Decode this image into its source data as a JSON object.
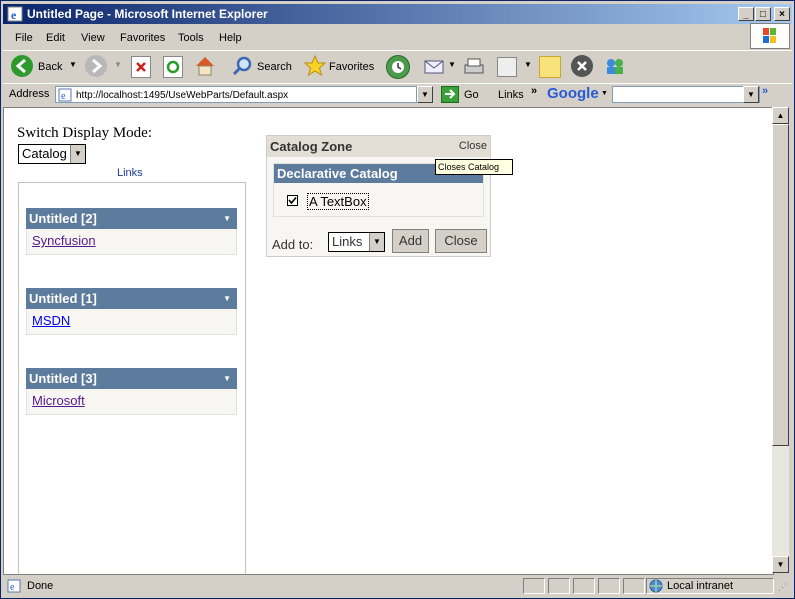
{
  "window": {
    "title": "Untitled Page - Microsoft Internet Explorer"
  },
  "menu": [
    "File",
    "Edit",
    "View",
    "Favorites",
    "Tools",
    "Help"
  ],
  "toolbar": {
    "back": "Back",
    "search": "Search",
    "favorites": "Favorites"
  },
  "address": {
    "label": "Address",
    "url": "http://localhost:1495/UseWebParts/Default.aspx",
    "go": "Go",
    "links": "Links",
    "google": "Google"
  },
  "page": {
    "switch_label": "Switch Display Mode:",
    "mode_value": "Catalog",
    "zone_title": "Links",
    "parts": [
      {
        "title": "Untitled [2]",
        "link": "Syncfusion"
      },
      {
        "title": "Untitled [1]",
        "link": "MSDN"
      },
      {
        "title": "Untitled [3]",
        "link": "Microsoft"
      }
    ],
    "catalog": {
      "title": "Catalog Zone",
      "close_link": "Close",
      "sub_title": "Declarative Catalog",
      "item_label": "A TextBox",
      "add_to_label": "Add to:",
      "add_to_value": "Links",
      "add_button": "Add",
      "close_button": "Close",
      "tooltip": "Closes Catalog"
    }
  },
  "status": {
    "text": "Done",
    "zone": "Local intranet"
  },
  "colors": {
    "title_start": "#0a246a",
    "title_end": "#a6caf0",
    "part_header": "#5d7b9d",
    "link_visited": "#551a8b"
  }
}
